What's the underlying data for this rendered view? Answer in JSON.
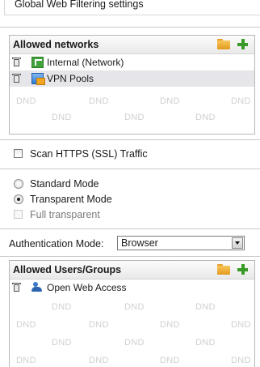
{
  "header": {
    "title": "Global Web Filtering settings"
  },
  "networks_panel": {
    "title": "Allowed networks",
    "items": [
      {
        "label": "Internal (Network)",
        "icon": "network-icon"
      },
      {
        "label": "VPN Pools",
        "icon": "vpn-pool-icon"
      }
    ],
    "placeholder": "DND"
  },
  "options": {
    "scan_https_label": "Scan HTTPS (SSL) Traffic",
    "standard_mode_label": "Standard Mode",
    "transparent_mode_label": "Transparent Mode",
    "full_transparent_label": "Full transparent",
    "selected_mode": "Transparent Mode"
  },
  "auth": {
    "label": "Authentication Mode:",
    "selected": "Browser"
  },
  "users_panel": {
    "title": "Allowed Users/Groups",
    "items": [
      {
        "label": "Open Web Access",
        "icon": "users-icon"
      }
    ],
    "placeholder": "DND"
  }
}
